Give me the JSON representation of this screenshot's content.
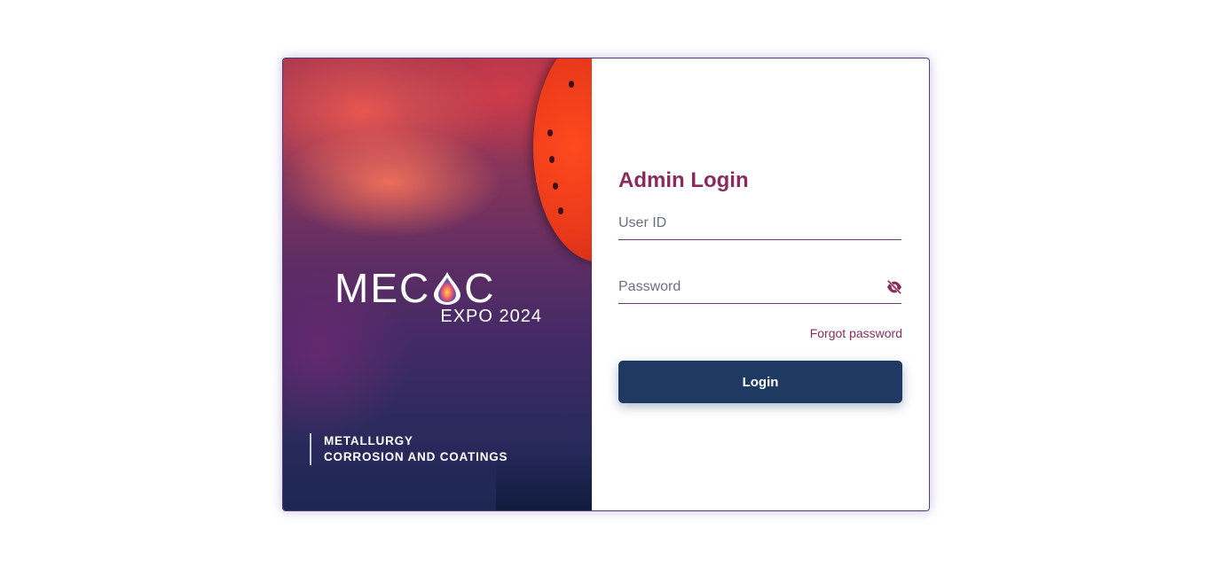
{
  "brand": {
    "logo_text": "MEC◉C",
    "logo_subtext": "EXPO 2024",
    "tagline_line1": "METALLURGY",
    "tagline_line2": "CORROSION AND COATINGS"
  },
  "login": {
    "title": "Admin Login",
    "user_id_placeholder": "User ID",
    "password_placeholder": "Password",
    "forgot_password_label": "Forgot password",
    "login_button_label": "Login"
  },
  "icons": {
    "password_toggle": "eye-slash-icon"
  },
  "colors": {
    "accent": "#8b2a5c",
    "button": "#1e3a63",
    "border": "#5a3a6e"
  }
}
